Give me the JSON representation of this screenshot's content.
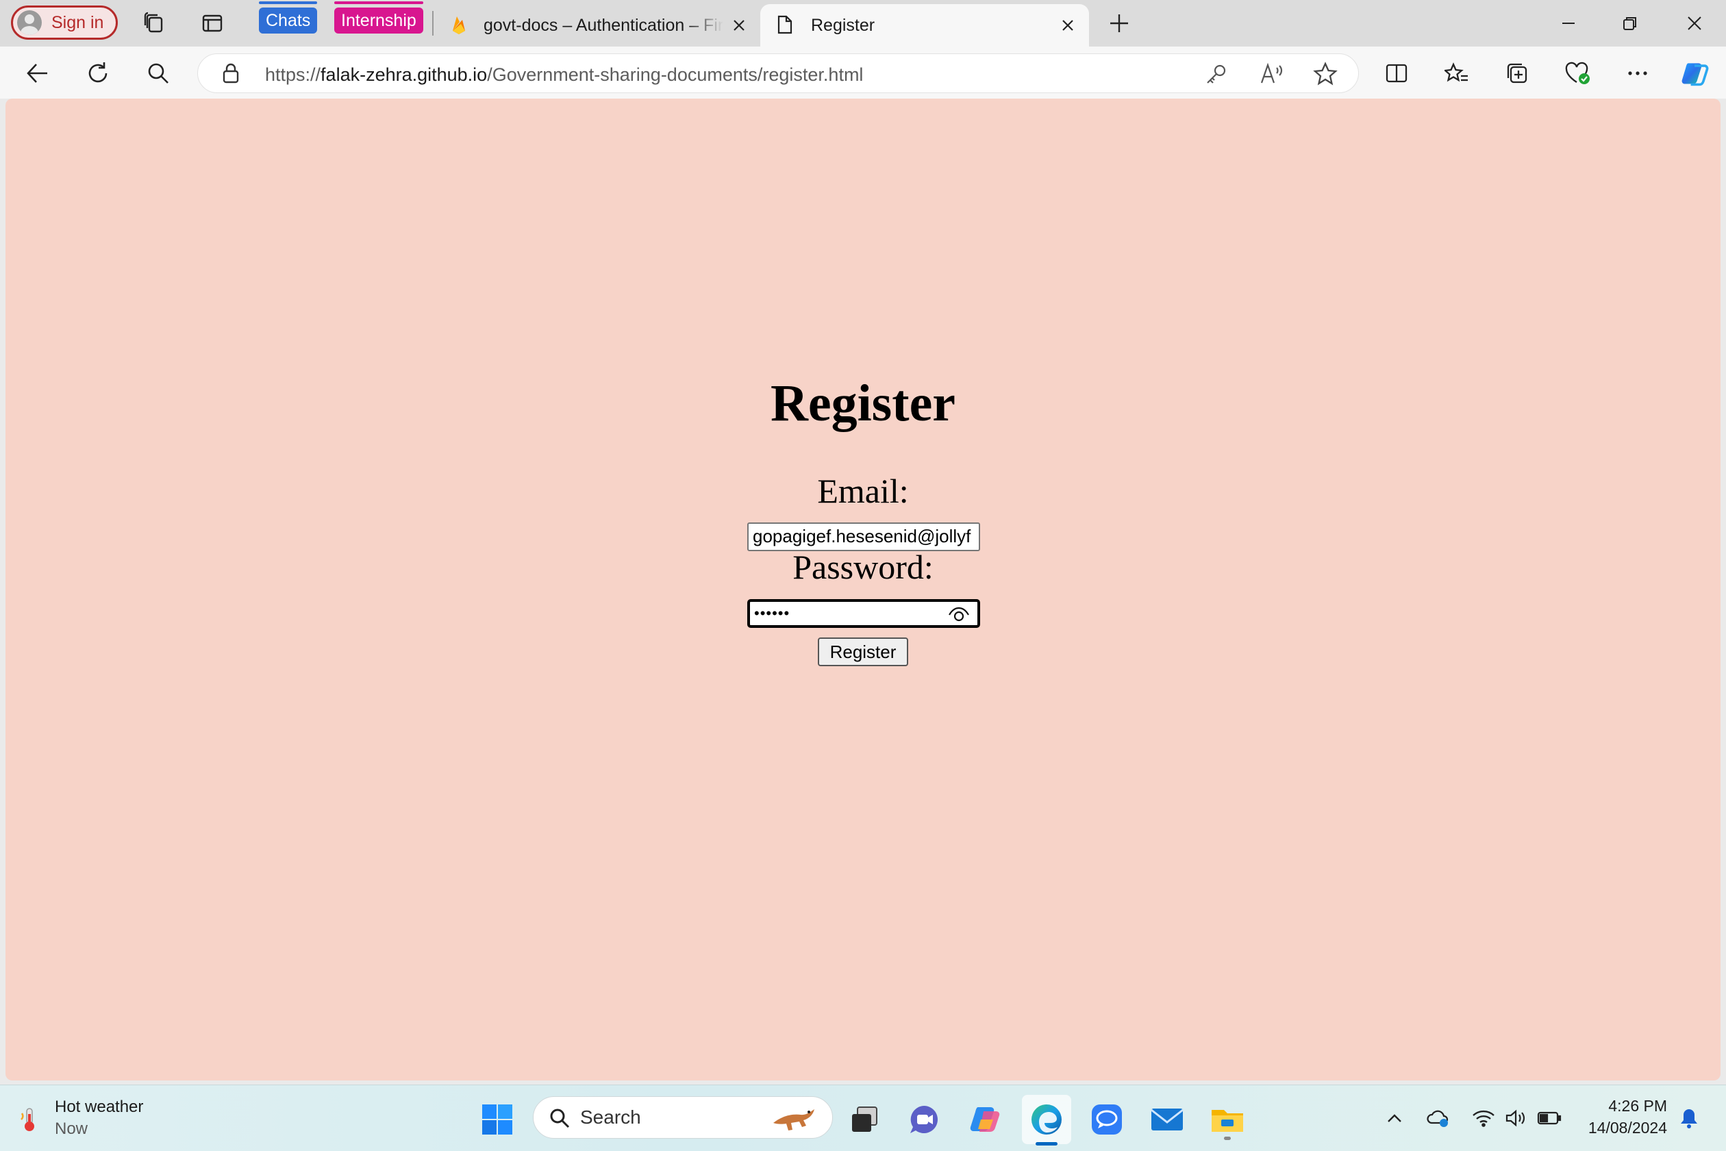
{
  "browser": {
    "sign_in_label": "Sign in",
    "tab_groups": [
      {
        "label": "Chats",
        "color": "#2f6fd6"
      },
      {
        "label": "Internship",
        "color": "#d8168f"
      }
    ],
    "tabs": [
      {
        "title": "govt-docs – Authentication – Firebase console",
        "favicon": "firebase-icon",
        "active": false
      },
      {
        "title": "Register",
        "favicon": "page-icon",
        "active": true
      }
    ],
    "address": {
      "scheme": "https://",
      "host": "falak-zehra.github.io",
      "path": "/Government-sharing-documents/register.html"
    }
  },
  "page": {
    "heading": "Register",
    "email_label": "Email:",
    "email_value": "gopagigef.hesesenid@jollyf",
    "password_label": "Password:",
    "password_masked": "••••••",
    "submit_label": "Register",
    "background_color": "#f7d3c8"
  },
  "taskbar": {
    "weather_title": "Hot weather",
    "weather_sub": "Now",
    "search_label": "Search",
    "time": "4:26 PM",
    "date": "14/08/2024"
  }
}
